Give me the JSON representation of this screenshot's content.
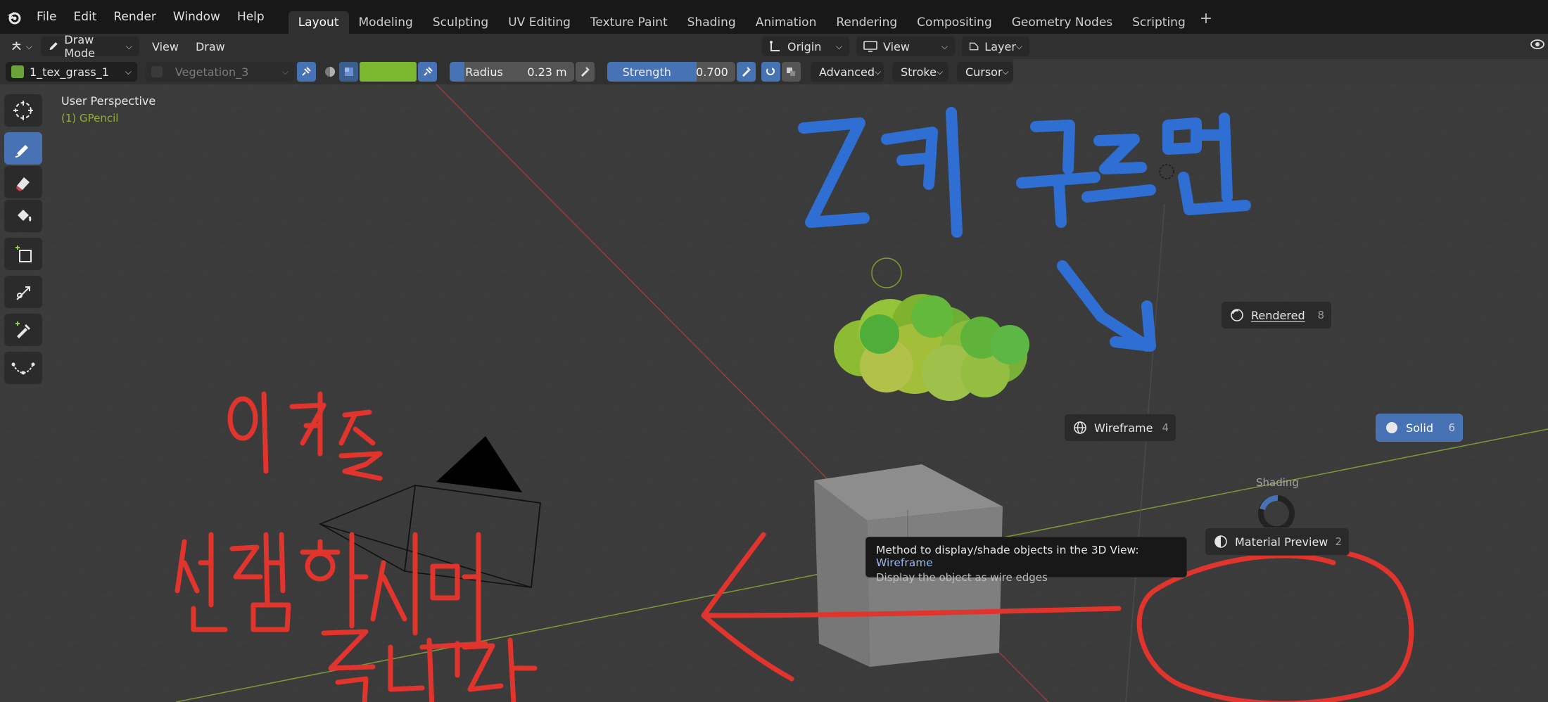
{
  "menu": {
    "items": [
      "File",
      "Edit",
      "Render",
      "Window",
      "Help"
    ]
  },
  "workspaces": {
    "tabs": [
      "Layout",
      "Modeling",
      "Sculpting",
      "UV Editing",
      "Texture Paint",
      "Shading",
      "Animation",
      "Rendering",
      "Compositing",
      "Geometry Nodes",
      "Scripting"
    ],
    "active": "Layout",
    "add_label": "+"
  },
  "header": {
    "mode": "Draw Mode",
    "view": "View",
    "draw": "Draw",
    "origin": "Origin",
    "view_dd": "View",
    "layer": "Layer"
  },
  "tool_settings": {
    "material": "1_tex_grass_1",
    "layer_material": "Vegetation_3",
    "color_hex": "#7cb82f",
    "radius_label": "Radius",
    "radius_value": "0.23 m",
    "radius_fill": 0.12,
    "strength_label": "Strength",
    "strength_value": "0.700",
    "strength_fill": 0.7,
    "advanced": "Advanced",
    "stroke": "Stroke",
    "cursor": "Cursor"
  },
  "viewport": {
    "perspective": "User Perspective",
    "object": "(1) GPencil"
  },
  "pie_menu": {
    "title": "Shading",
    "rendered": {
      "label": "Rendered",
      "key": "8"
    },
    "wireframe": {
      "label": "Wireframe",
      "key": "4"
    },
    "solid": {
      "label": "Solid",
      "key": "6"
    },
    "material_preview": {
      "label": "Material Preview",
      "key": "2"
    }
  },
  "tooltip": {
    "line1_prefix": "Method to display/shade objects in the 3D View:",
    "line1_value": "Wireframe",
    "line2": "Display the object as wire edges"
  },
  "colors": {
    "accent": "#4772b3",
    "annotation_blue": "#2f6fd4",
    "annotation_red": "#e0342d"
  },
  "annotations": {
    "blue_text": "Z키 누르면",
    "red_text_1": "이것을",
    "red_text_2": "선택하시면",
    "red_text_3": "됩니다"
  }
}
